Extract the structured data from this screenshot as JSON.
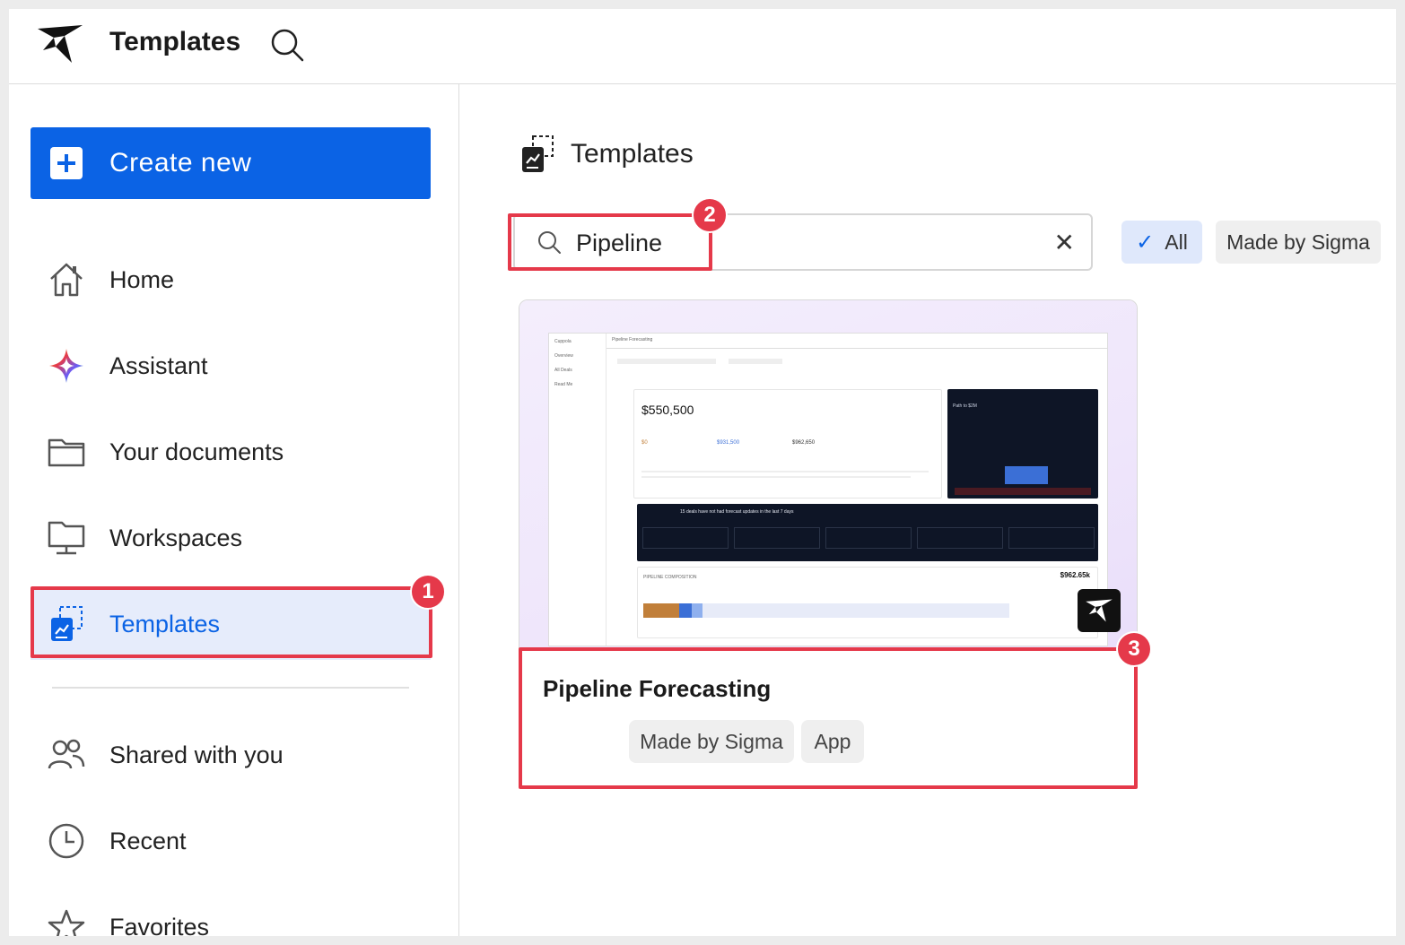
{
  "topbar": {
    "title": "Templates"
  },
  "sidebar": {
    "create_label": "Create new",
    "items": [
      {
        "label": "Home",
        "icon": "home-icon"
      },
      {
        "label": "Assistant",
        "icon": "assistant-icon"
      },
      {
        "label": "Your documents",
        "icon": "folder-icon"
      },
      {
        "label": "Workspaces",
        "icon": "workspace-icon"
      },
      {
        "label": "Templates",
        "icon": "templates-icon",
        "active": true
      },
      {
        "label": "Shared with you",
        "icon": "people-icon"
      },
      {
        "label": "Recent",
        "icon": "clock-icon"
      },
      {
        "label": "Favorites",
        "icon": "star-icon"
      }
    ]
  },
  "main": {
    "heading": "Templates",
    "search": {
      "value": "Pipeline",
      "clear": "✕"
    },
    "filters": {
      "all": "All",
      "made_by_sigma": "Made by Sigma"
    },
    "card": {
      "title": "Pipeline Forecasting",
      "tags": [
        "Made by Sigma",
        "App"
      ],
      "preview": {
        "sidebar_items": [
          "Cuppola",
          "Overview",
          "All Deals",
          "Read Me"
        ],
        "header": "Pipeline Forecasting",
        "kpi_value": "$550,500",
        "stats": [
          "$0",
          "$931,500",
          "$962,650"
        ],
        "dark_title": "Path to $2M",
        "next_text": "15 deals have not had forecast updates in the last 7 days",
        "composition_label": "PIPELINE COMPOSITION",
        "composition_total": "$962.65k"
      }
    }
  },
  "annotations": [
    "1",
    "2",
    "3"
  ],
  "colors": {
    "accent": "#0b63e5",
    "highlight": "#e5394a",
    "active_bg": "#e6ecfb"
  }
}
